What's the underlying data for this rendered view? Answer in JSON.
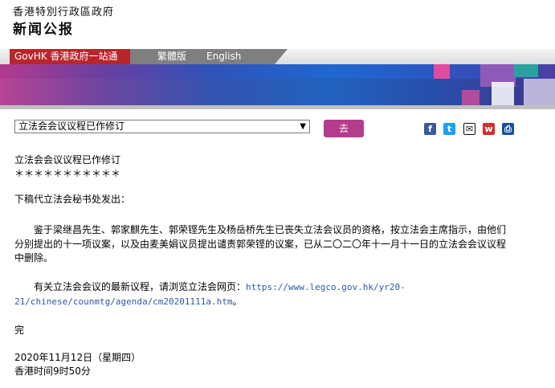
{
  "header": {
    "gov_name": "香港特別行政區政府",
    "title": "新闻公报"
  },
  "nav": {
    "govhk": "GovHK 香港政府一站通",
    "traditional": "繁體版",
    "english": "English"
  },
  "toolbar": {
    "select_value": "立法会会议议程已作修订",
    "go_label": "去"
  },
  "share": {
    "icons": [
      "facebook-icon",
      "twitter-icon",
      "email-icon",
      "weibo-icon",
      "print-icon"
    ],
    "colors": [
      "#3b5998",
      "#1da1f2",
      "#111111",
      "#d32f2f",
      "#1a4fa0"
    ]
  },
  "article": {
    "title": "立法会会议议程已作修订",
    "stars": "＊＊＊＊＊＊＊＊＊＊＊",
    "intro": "下稿代立法会秘书处发出：",
    "para1_line1": "鉴于梁继昌先生、郭家麒先生、郭荣铿先生及杨岳桥先生已丧失立法会议员的资格，按立法会主席指示，由他们",
    "para1_line2": "分别提出的十一项议案，以及由麦美娟议员提出谴责郭荣铿的议案，已从二〇二〇年十一月十一日的立法会会议议程",
    "para1_line3": "中删除。",
    "para2_prefix": "有关立法会会议的最新议程，请浏览立法会网页：",
    "link_line1": "https://www.legco.gov.hk/yr20-",
    "link_line2": "21/chinese/counmtg/agenda/cm20201111a.htm",
    "para2_suffix": "。",
    "end": "完",
    "date": "2020年11月12日（星期四）",
    "time": "香港时间9时50分"
  }
}
